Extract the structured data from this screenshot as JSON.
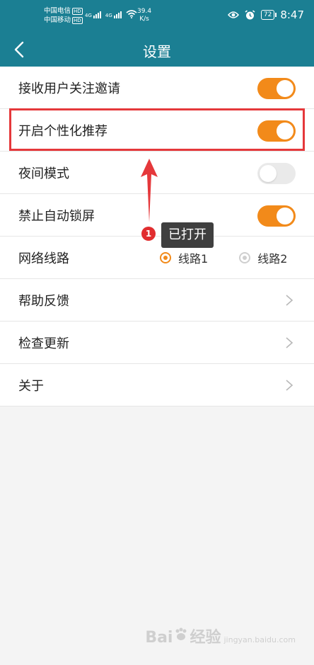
{
  "status_bar": {
    "carrier1": "中国电信",
    "carrier2": "中国移动",
    "hd": "HD",
    "net_type": "4G",
    "speed_value": "39.4",
    "speed_unit": "K/s",
    "battery": "72",
    "time": "8:47",
    "icons": [
      "eye-icon",
      "alarm-icon",
      "wifi-icon",
      "signal-icon"
    ]
  },
  "header": {
    "title": "设置",
    "back_icon": "chevron-left-icon"
  },
  "settings": {
    "items": [
      {
        "label": "接收用户关注邀请",
        "type": "toggle",
        "on": true
      },
      {
        "label": "开启个性化推荐",
        "type": "toggle",
        "on": true
      },
      {
        "label": "夜间模式",
        "type": "toggle",
        "on": false
      },
      {
        "label": "禁止自动锁屏",
        "type": "toggle",
        "on": true
      },
      {
        "label": "网络线路",
        "type": "radio",
        "options": [
          "线路1",
          "线路2"
        ],
        "selected": "线路1"
      },
      {
        "label": "帮助反馈",
        "type": "link"
      },
      {
        "label": "检查更新",
        "type": "link"
      },
      {
        "label": "关于",
        "type": "link"
      }
    ]
  },
  "annotation": {
    "step_number": "1",
    "callout_text": "已打开"
  },
  "watermark": {
    "text_left": "Bai",
    "text_right": "经验",
    "text_sub": "jingyan.baidu.com"
  },
  "colors": {
    "primary": "#1b7f93",
    "accent": "#f28a1a",
    "highlight": "#e5383b"
  }
}
